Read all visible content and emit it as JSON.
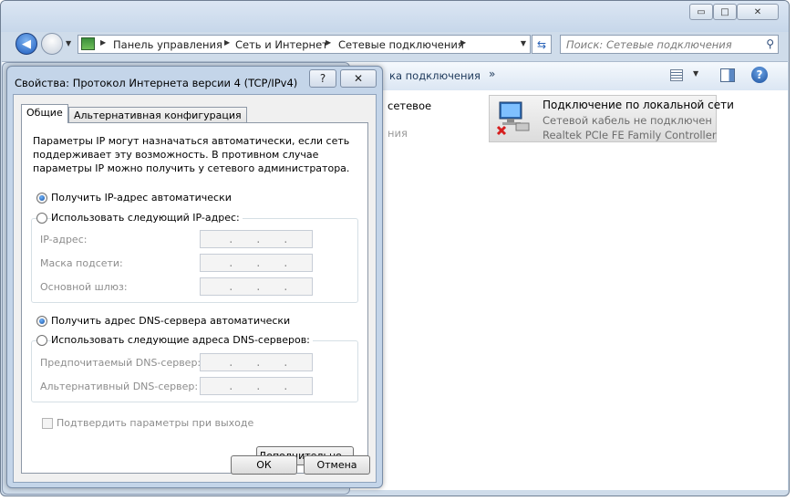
{
  "explorer": {
    "window_controls": {
      "minimize": "▭",
      "maximize": "□",
      "close": "✕"
    },
    "breadcrumbs": [
      "Панель управления",
      "Сеть и Интернет",
      "Сетевые подключения"
    ],
    "search_placeholder": "Поиск: Сетевые подключения",
    "toolbar_partial": "ка подключения",
    "toolbar_more": "»",
    "partial_text_1": "сетевое",
    "partial_text_2": "ния",
    "connection": {
      "title": "Подключение по локальной сети",
      "status": "Сетевой кабель не подключен",
      "adapter": "Realtek PCIe FE Family Controller"
    }
  },
  "dialog": {
    "title": "Свойства: Протокол Интернета версии 4 (TCP/IPv4)",
    "help_glyph": "?",
    "close_glyph": "✕",
    "tabs": [
      "Общие",
      "Альтернативная конфигурация"
    ],
    "intro_text": "Параметры IP могут назначаться автоматически, если сеть поддерживает эту возможность. В противном случае параметры IP можно получить у сетевого администратора.",
    "ip": {
      "auto_label": "Получить IP-адрес автоматически",
      "manual_label": "Использовать следующий IP-адрес:",
      "auto_selected": true,
      "fields": [
        "IP-адрес:",
        "Маска подсети:",
        "Основной шлюз:"
      ]
    },
    "dns": {
      "auto_label": "Получить адрес DNS-сервера автоматически",
      "manual_label": "Использовать следующие адреса DNS-серверов:",
      "auto_selected": true,
      "fields": [
        "Предпочитаемый DNS-сервер:",
        "Альтернативный DNS-сервер:"
      ]
    },
    "validate_label": "Подтвердить параметры при выходе",
    "advanced_button": "Дополнительно...",
    "ok_button": "ОК",
    "cancel_button": "Отмена"
  }
}
